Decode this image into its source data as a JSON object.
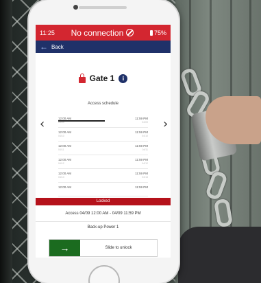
{
  "status_bar": {
    "time": "11:25",
    "connection": "No connection",
    "connection_icon": "no-connection-icon",
    "battery": "75%",
    "color": "#d32630"
  },
  "nav": {
    "back_label": "Back",
    "color": "#1f3169"
  },
  "gate": {
    "name": "Gate 1",
    "lock_icon": "lock-icon",
    "info_icon": "info-icon",
    "info_glyph": "i"
  },
  "schedule": {
    "title": "Access schedule",
    "prev_glyph": "‹",
    "next_glyph": "›",
    "current_progress_fraction": 0.52,
    "rows": [
      {
        "start": "12:00 AM",
        "end": "11:59 PM",
        "start_date": "04/09",
        "end_date": "04/09"
      },
      {
        "start": "12:00 AM",
        "end": "11:59 PM",
        "start_date": "04/10",
        "end_date": "04/10"
      },
      {
        "start": "12:00 AM",
        "end": "11:59 PM",
        "start_date": "04/11",
        "end_date": "04/11"
      },
      {
        "start": "12:00 AM",
        "end": "11:59 PM",
        "start_date": "04/12",
        "end_date": "04/12"
      },
      {
        "start": "12:00 AM",
        "end": "11:59 PM",
        "start_date": "04/13",
        "end_date": "04/13"
      },
      {
        "start": "12:00 AM",
        "end": "11:59 PM",
        "start_date": "",
        "end_date": ""
      }
    ]
  },
  "status": {
    "locked_label": "Locked",
    "locked_color": "#b5121b",
    "access_text": "Access 04/09 12:00 AM - 04/09 11:59 PM",
    "backup_text": "Back-up Power 1"
  },
  "slider": {
    "thumb_glyph": "→",
    "label": "Slide to unlock",
    "thumb_color": "#1b6b1f"
  }
}
